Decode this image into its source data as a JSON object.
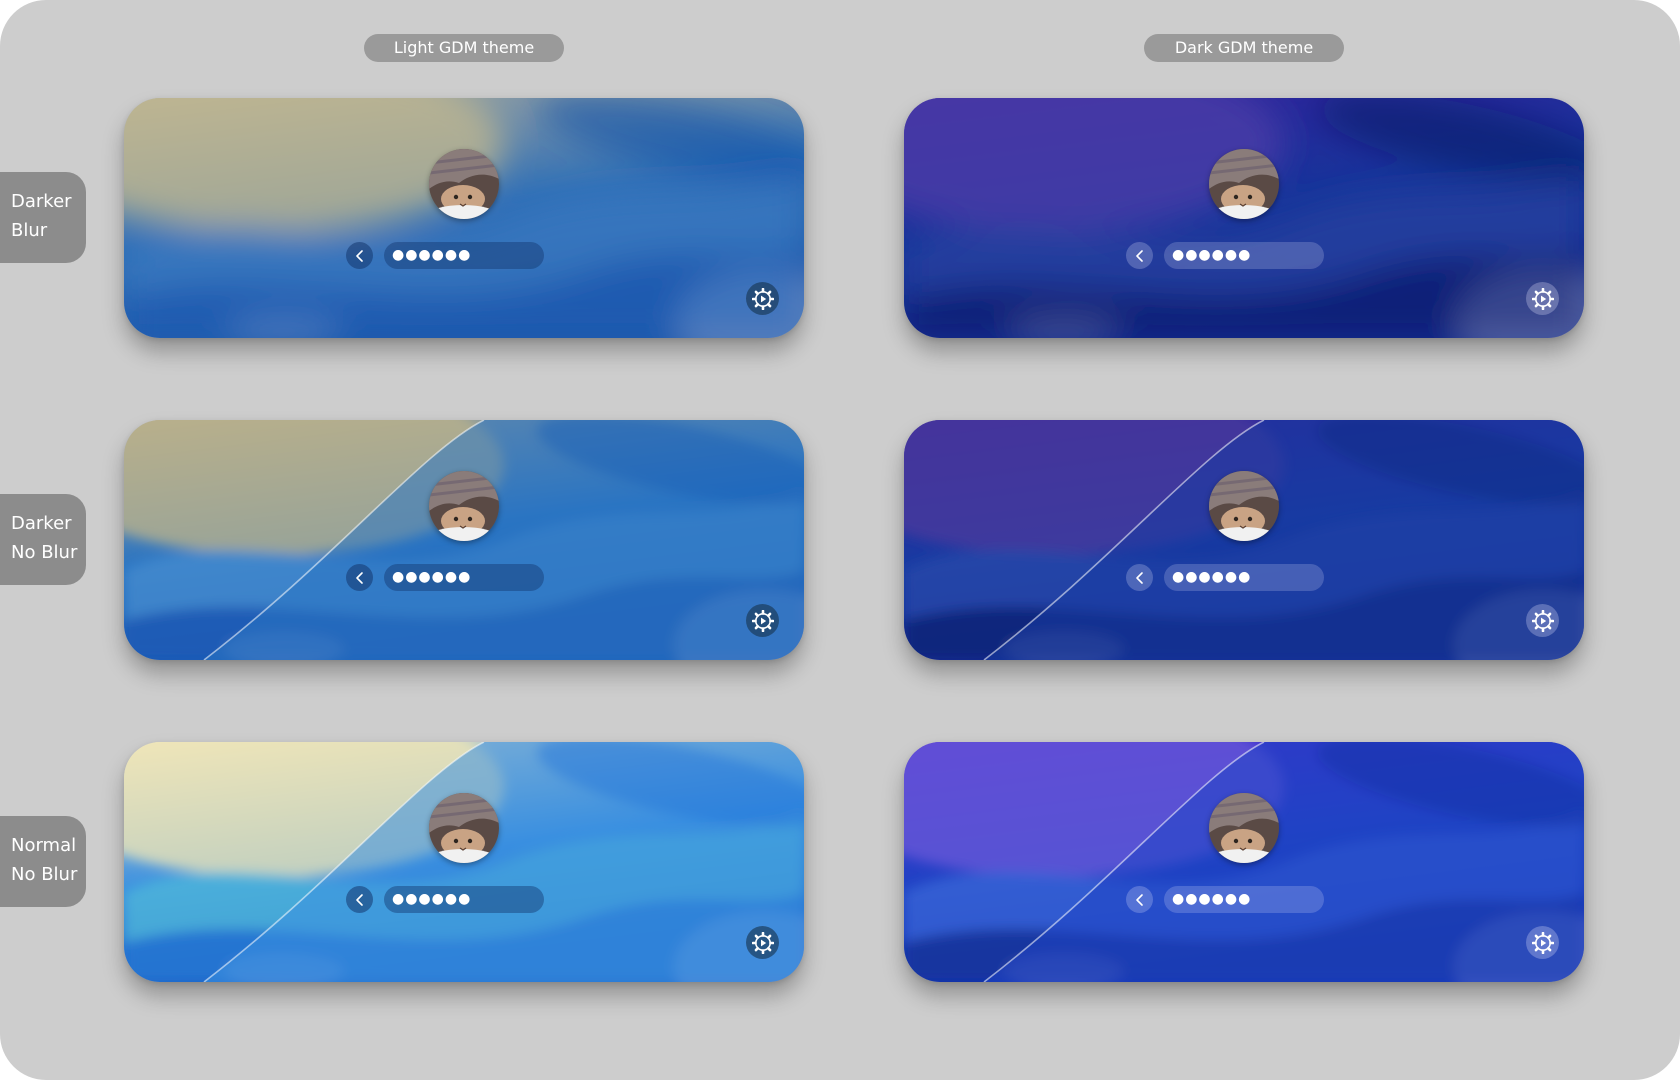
{
  "columns": [
    {
      "id": "light",
      "label": "Light GDM theme"
    },
    {
      "id": "dark",
      "label": "Dark GDM theme"
    }
  ],
  "rows": [
    {
      "id": "darker-blur",
      "label_lines": [
        "Darker",
        "Blur"
      ]
    },
    {
      "id": "darker-no-blur",
      "label_lines": [
        "Darker",
        "No Blur"
      ]
    },
    {
      "id": "normal-no-blur",
      "label_lines": [
        "Normal",
        "No Blur"
      ]
    }
  ],
  "login": {
    "password_mask": "●●●●●●",
    "avatar_icon": "user-avatar-cat",
    "back_icon": "chevron-left-icon",
    "settings_icon": "gear-icon"
  },
  "colors": {
    "canvas": "#cdcdcd",
    "label_bg": "#8c8c8c",
    "header_bg": "#9a9a9a",
    "light_primary": "#1d5bb8",
    "dark_primary": "#1a2aa0"
  },
  "variants": {
    "light": {
      "darker-blur": {
        "top": "#a6a89e",
        "mid": "#2f6fb6",
        "bottom": "#1a59ac",
        "glow": "#c6b98e",
        "accent": "#3d7bc2",
        "wave": "#0b48a8",
        "blur": 16,
        "edge": false
      },
      "darker-no-blur": {
        "top": "#a7a391",
        "mid": "#2a74c2",
        "bottom": "#0f54b4",
        "glow": "#bfb48a",
        "accent": "#4a8fd0",
        "wave": "#0a3ea6",
        "blur": 6,
        "edge": true
      },
      "normal-no-blur": {
        "top": "#e4e0c6",
        "mid": "#3a8fe0",
        "bottom": "#1456c2",
        "glow": "#f3e7b4",
        "accent": "#53bcd8",
        "wave": "#0c4fd0",
        "blur": 6,
        "edge": true
      }
    },
    "dark": {
      "darker-blur": {
        "top": "#33239c",
        "mid": "#15349a",
        "bottom": "#0b2790",
        "glow": "#4c3fa8",
        "accent": "#26429f",
        "wave": "#04115c",
        "blur": 16,
        "edge": false
      },
      "darker-no-blur": {
        "top": "#342198",
        "mid": "#183ba2",
        "bottom": "#0a2694",
        "glow": "#4a3b9c",
        "accent": "#2a4aaa",
        "wave": "#04125e",
        "blur": 6,
        "edge": true
      },
      "normal-no-blur": {
        "top": "#4a2ad0",
        "mid": "#1f43c4",
        "bottom": "#0a2bb0",
        "glow": "#6a5ad8",
        "accent": "#3a6ad8",
        "wave": "#06177a",
        "blur": 6,
        "edge": true
      }
    }
  }
}
